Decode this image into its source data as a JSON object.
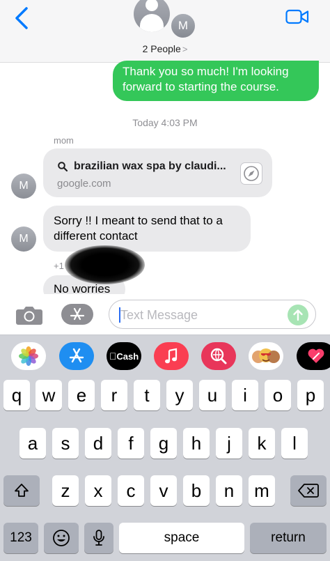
{
  "header": {
    "avatar_initial": "M",
    "people_label": "2 People",
    "people_chevron": ">"
  },
  "messages": {
    "outgoing_1": "Thank you so much! I'm looking forward to starting the course.",
    "timestamp": "Today 4:03 PM",
    "sender_name": "mom",
    "link_preview": {
      "title": "brazilian wax spa by claudi...",
      "domain": "google.com"
    },
    "avatar_initial": "M",
    "incoming_2": "Sorry !! I meant to send that to a different contact",
    "phone_prefix": "+1",
    "incoming_3": "No worries"
  },
  "composer": {
    "placeholder": "Text Message"
  },
  "app_drawer": {
    "icons": [
      "photos-icon",
      "app-store-icon",
      "apple-cash-icon",
      "music-icon",
      "web-search-icon",
      "memoji-icon",
      "digital-touch-icon"
    ],
    "cash_label": "Cash"
  },
  "keyboard": {
    "row1": [
      "q",
      "w",
      "e",
      "r",
      "t",
      "y",
      "u",
      "i",
      "o",
      "p"
    ],
    "row2": [
      "a",
      "s",
      "d",
      "f",
      "g",
      "h",
      "j",
      "k",
      "l"
    ],
    "row3": [
      "z",
      "x",
      "c",
      "v",
      "b",
      "n",
      "m"
    ],
    "numbers_label": "123",
    "space_label": "space",
    "return_label": "return"
  },
  "colors": {
    "outgoing_bubble": "#34c759",
    "incoming_bubble": "#e9e9eb",
    "accent_blue": "#007aff",
    "keyboard_bg": "#d1d3d9"
  }
}
